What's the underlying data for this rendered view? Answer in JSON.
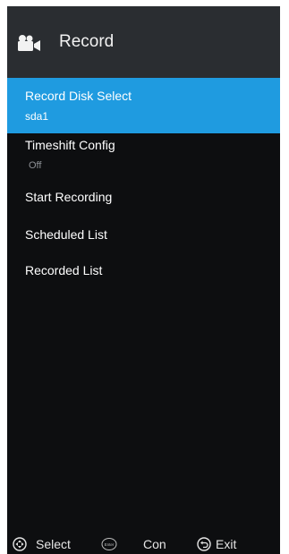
{
  "header": {
    "title": "Record",
    "icon": "video-camera-icon"
  },
  "menu": {
    "items": [
      {
        "label": "Record Disk Select",
        "value": "sda1",
        "selected": true
      },
      {
        "label": "Timeshift Config",
        "value": "Off",
        "selected": false
      },
      {
        "label": "Start Recording",
        "selected": false
      },
      {
        "label": "Scheduled List",
        "selected": false
      },
      {
        "label": "Recorded List",
        "selected": false
      }
    ]
  },
  "footer": {
    "select_icon": "dpad-icon",
    "select_label": "Select",
    "enter_icon": "enter-icon",
    "enter_icon_text": "Enter",
    "confirm_label": "Con",
    "back_icon": "back-icon",
    "exit_label": "Exit"
  },
  "colors": {
    "panel_background": "#0d0e10",
    "header_background": "#2a2d31",
    "selected_background": "#1f9be0",
    "secondary_text": "#8e9196"
  }
}
